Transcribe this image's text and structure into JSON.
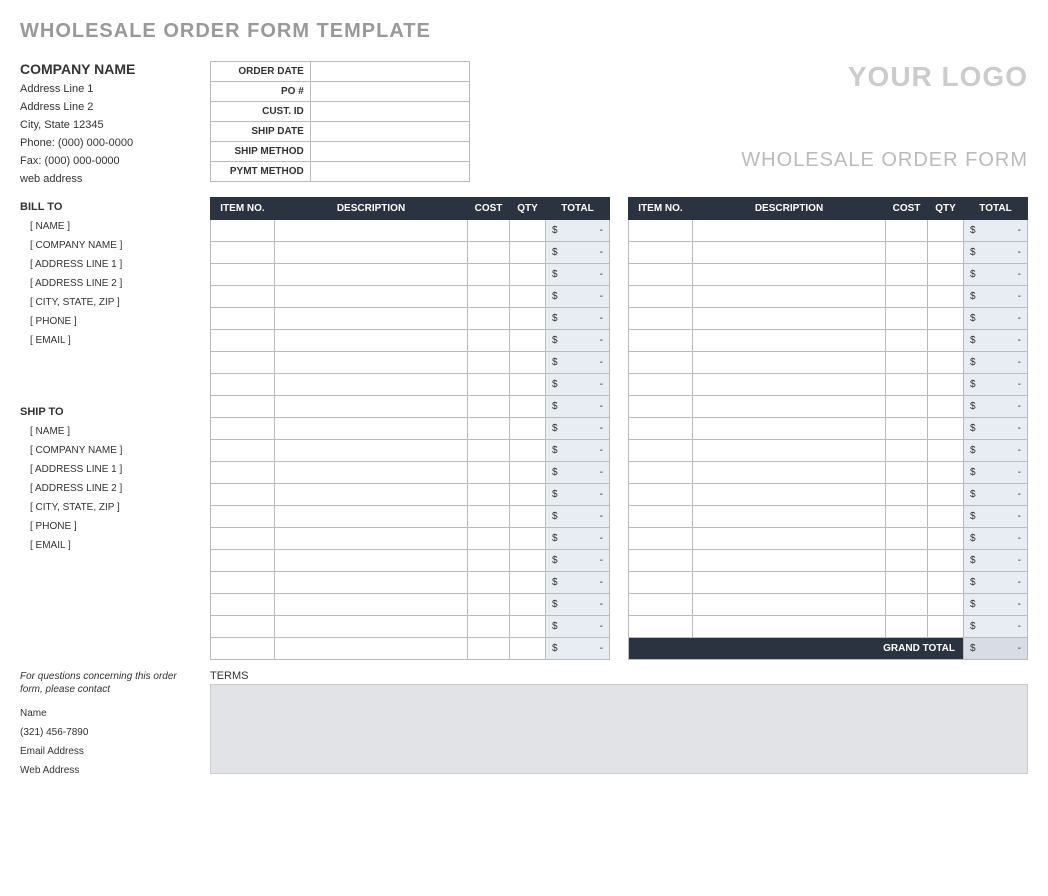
{
  "page_title": "WHOLESALE ORDER FORM TEMPLATE",
  "company": {
    "name": "COMPANY NAME",
    "address1": "Address Line 1",
    "address2": "Address Line 2",
    "city_state_zip": "City, State  12345",
    "phone": "Phone: (000) 000-0000",
    "fax": "Fax: (000) 000-0000",
    "web": "web address"
  },
  "meta_labels": {
    "order_date": "ORDER DATE",
    "po": "PO #",
    "cust_id": "CUST. ID",
    "ship_date": "SHIP DATE",
    "ship_method": "SHIP METHOD",
    "pymt_method": "PYMT METHOD"
  },
  "logo_text": "YOUR LOGO",
  "form_title": "WHOLESALE ORDER FORM",
  "bill_to": {
    "label": "BILL TO",
    "fields": [
      "[ NAME ]",
      "[ COMPANY NAME ]",
      "[ ADDRESS LINE 1 ]",
      "[ ADDRESS LINE 2 ]",
      "[ CITY, STATE, ZIP ]",
      "[ PHONE ]",
      "[ EMAIL ]"
    ]
  },
  "ship_to": {
    "label": "SHIP TO",
    "fields": [
      "[ NAME ]",
      "[ COMPANY NAME ]",
      "[ ADDRESS LINE 1 ]",
      "[ ADDRESS LINE 2 ]",
      "[ CITY, STATE, ZIP ]",
      "[ PHONE ]",
      "[ EMAIL ]"
    ]
  },
  "headers": {
    "item_no": "ITEM NO.",
    "description": "DESCRIPTION",
    "cost": "COST",
    "qty": "QTY",
    "total": "TOTAL"
  },
  "row_count_left": 20,
  "row_count_right": 19,
  "currency": "$",
  "empty_dash": "-",
  "grand_total_label": "GRAND TOTAL",
  "contact": {
    "note": "For questions concerning this order form, please contact",
    "name": "Name",
    "phone": "(321) 456-7890",
    "email": "Email Address",
    "web": "Web Address"
  },
  "terms_label": "TERMS"
}
